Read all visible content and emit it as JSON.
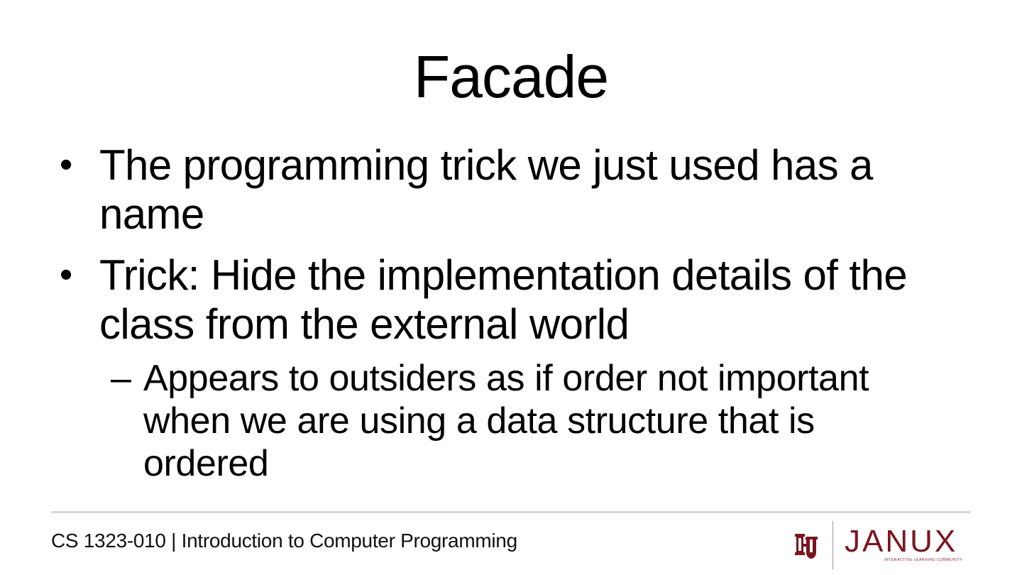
{
  "slide": {
    "title": "Facade",
    "bullets": [
      {
        "marker": "•",
        "text": "The programming trick we just used has a name"
      },
      {
        "marker": "•",
        "text": "Trick: Hide the implementation details of the class from the external world"
      }
    ],
    "sub_bullets": [
      {
        "marker": "–",
        "text": "Appears to outsiders as if order not important when we are using a data structure that is ordered"
      }
    ]
  },
  "footer": {
    "course": "CS 1323-010 | Introduction to Computer Programming",
    "logo_wordmark": "JANUX",
    "logo_tagline": "INTERACTIVE LEARNING COMMUNITY"
  },
  "colors": {
    "brand_crimson": "#7a1520",
    "rule": "#d8d8d8"
  }
}
